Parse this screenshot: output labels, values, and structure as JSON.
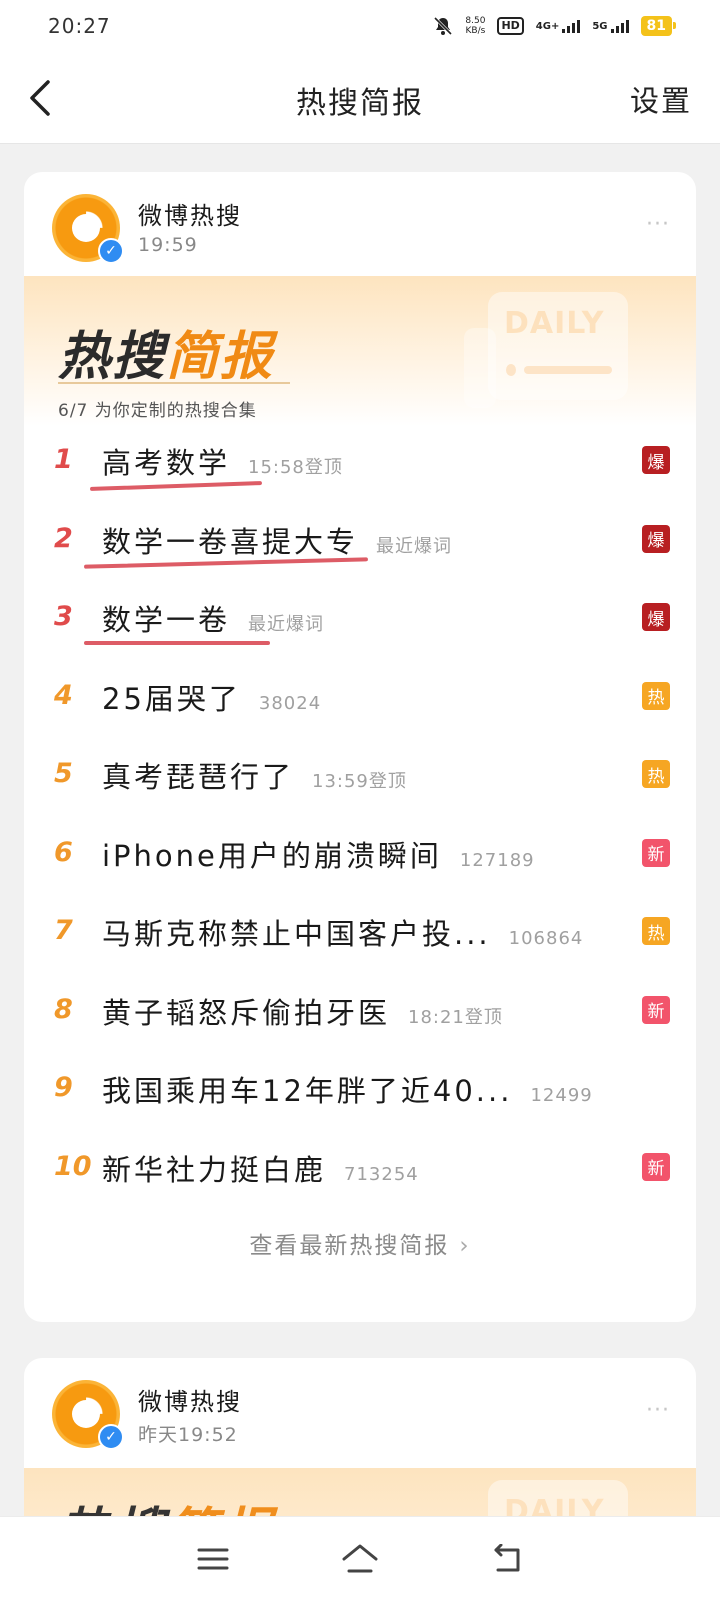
{
  "status_bar": {
    "time": "20:27",
    "net_speed": "8.50",
    "net_speed_unit": "KB/s",
    "hd_label": "HD",
    "net_4g": "4G+",
    "net_5g": "5G",
    "battery": "81"
  },
  "nav": {
    "title": "热搜简报",
    "settings_label": "设置",
    "back_icon": "chevron-left-icon"
  },
  "posts": [
    {
      "account_name": "微博热搜",
      "time": "19:59",
      "more": "···",
      "banner": {
        "title_part1": "热搜",
        "title_part2": "简报",
        "daily_label": "DAILY",
        "subtitle": "6/7 为你定制的热搜合集"
      },
      "items": [
        {
          "rank": "1",
          "title": "高考数学",
          "meta": "15:58登顶",
          "tag": "爆"
        },
        {
          "rank": "2",
          "title": "数学一卷喜提大专",
          "meta": "最近爆词",
          "tag": "爆"
        },
        {
          "rank": "3",
          "title": "数学一卷",
          "meta": "最近爆词",
          "tag": "爆"
        },
        {
          "rank": "4",
          "title": "25届哭了",
          "meta": "38024",
          "tag": "热"
        },
        {
          "rank": "5",
          "title": "真考琵琶行了",
          "meta": "13:59登顶",
          "tag": "热"
        },
        {
          "rank": "6",
          "title": "iPhone用户的崩溃瞬间",
          "meta": "127189",
          "tag": "新"
        },
        {
          "rank": "7",
          "title": "马斯克称禁止中国客户投...",
          "meta": "106864",
          "tag": "热"
        },
        {
          "rank": "8",
          "title": "黄子韬怒斥偷拍牙医",
          "meta": "18:21登顶",
          "tag": "新"
        },
        {
          "rank": "9",
          "title": "我国乘用车12年胖了近40...",
          "meta": "12499",
          "tag": ""
        },
        {
          "rank": "10",
          "title": "新华社力挺白鹿",
          "meta": "713254",
          "tag": "新"
        }
      ],
      "footer_link": "查看最新热搜简报"
    },
    {
      "account_name": "微博热搜",
      "time": "昨天19:52",
      "more": "···",
      "banner": {
        "title_part1": "热搜",
        "title_part2": "简报",
        "daily_label": "DAILY"
      }
    }
  ],
  "bottom_nav": {
    "menu_icon": "menu-icon",
    "home_icon": "home-icon",
    "back_icon": "return-icon"
  },
  "colors": {
    "tag_bao": "#b81f22",
    "tag_re": "#f6a623",
    "tag_xin": "#f2546b",
    "rank_top": "#e04b4b",
    "rank_other": "#f0982a",
    "accent_orange": "#f08a14",
    "handwritten_underline": "#d94a55"
  }
}
